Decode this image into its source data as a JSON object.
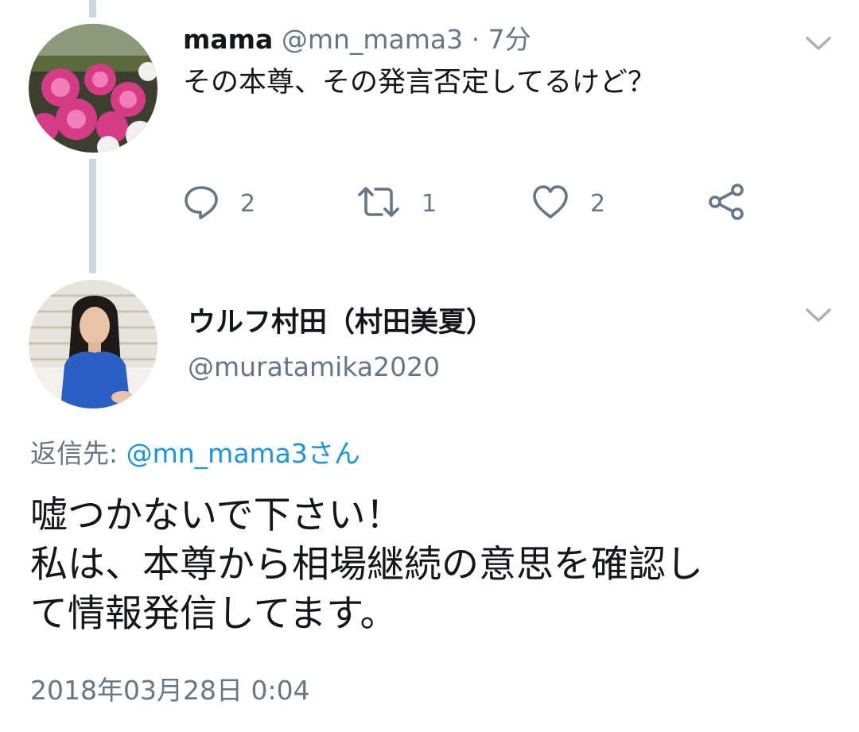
{
  "tweet1": {
    "display_name": "mama",
    "handle": "@mn_mama3",
    "separator": "·",
    "time_ago": "7分",
    "text": "その本尊、その発言否定してるけど？",
    "reply_count": "2",
    "retweet_count": "1",
    "like_count": "2",
    "icons": [
      "reply-icon",
      "retweet-icon",
      "like-icon",
      "share-icon",
      "chevron-down-icon"
    ]
  },
  "tweet2": {
    "display_name": "ウルフ村田（村田美夏）",
    "handle": "@muratamika2020",
    "reply_to_label": "返信先: ",
    "reply_to_mention": "@mn_mama3さん",
    "lines": [
      "嘘つかないで下さい！",
      "私は、本尊から相場継続の意思を確認し",
      "て情報発信してます。"
    ],
    "timestamp": "2018年03月28日 0:04"
  },
  "colors": {
    "text": "#14171a",
    "secondary": "#657786",
    "link": "#1b95e0",
    "thread_line": "#ccd6dd"
  }
}
